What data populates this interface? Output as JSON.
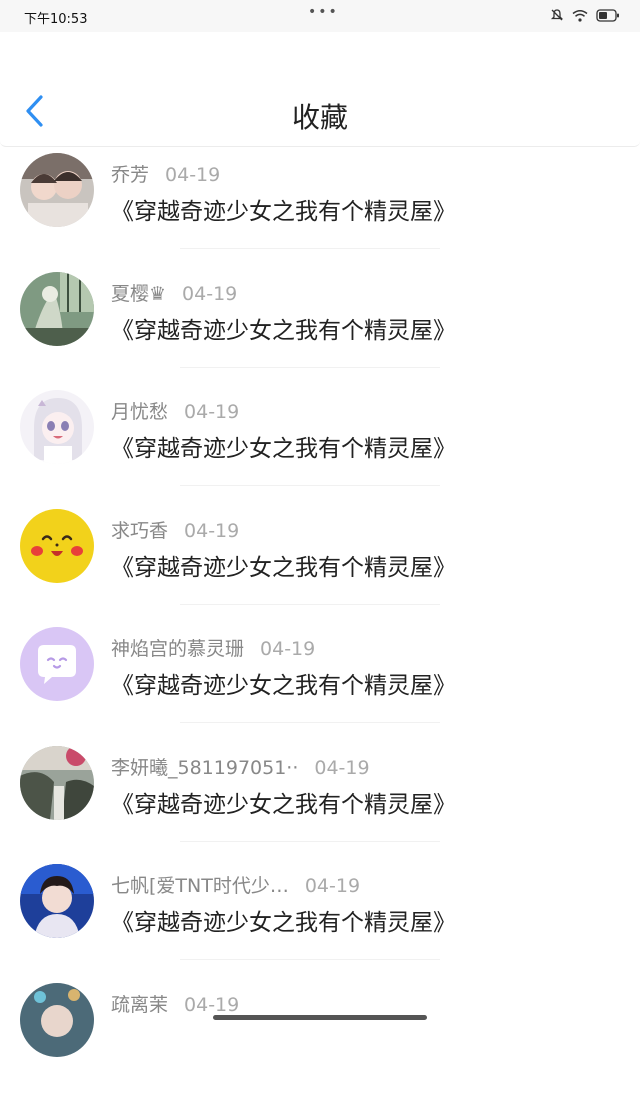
{
  "status_bar": {
    "time": "下午10:53",
    "dots": "•••"
  },
  "header": {
    "title": "收藏"
  },
  "items": [
    {
      "name": "乔芳",
      "date": "04-19",
      "book": "《穿越奇迹少女之我有个精灵屋》"
    },
    {
      "name": "夏樱♛",
      "date": "04-19",
      "book": "《穿越奇迹少女之我有个精灵屋》"
    },
    {
      "name": "月忧愁",
      "date": "04-19",
      "book": "《穿越奇迹少女之我有个精灵屋》"
    },
    {
      "name": "求巧香",
      "date": "04-19",
      "book": "《穿越奇迹少女之我有个精灵屋》"
    },
    {
      "name": "神焰宫的慕灵珊",
      "date": "04-19",
      "book": "《穿越奇迹少女之我有个精灵屋》"
    },
    {
      "name": "李妍曦_581197051··",
      "date": "04-19",
      "book": "《穿越奇迹少女之我有个精灵屋》"
    },
    {
      "name": "七帆[爱TNT时代少…",
      "date": "04-19",
      "book": "《穿越奇迹少女之我有个精灵屋》"
    },
    {
      "name": "疏离茉",
      "date": "04-19",
      "book": ""
    }
  ],
  "colors": {
    "accent": "#2f8ff2",
    "pikachu": "#f2d21b",
    "chat_bg": "#d9c6f5"
  },
  "icons": [
    "back-chevron-icon",
    "mute-bell-icon",
    "wifi-icon",
    "battery-icon"
  ]
}
